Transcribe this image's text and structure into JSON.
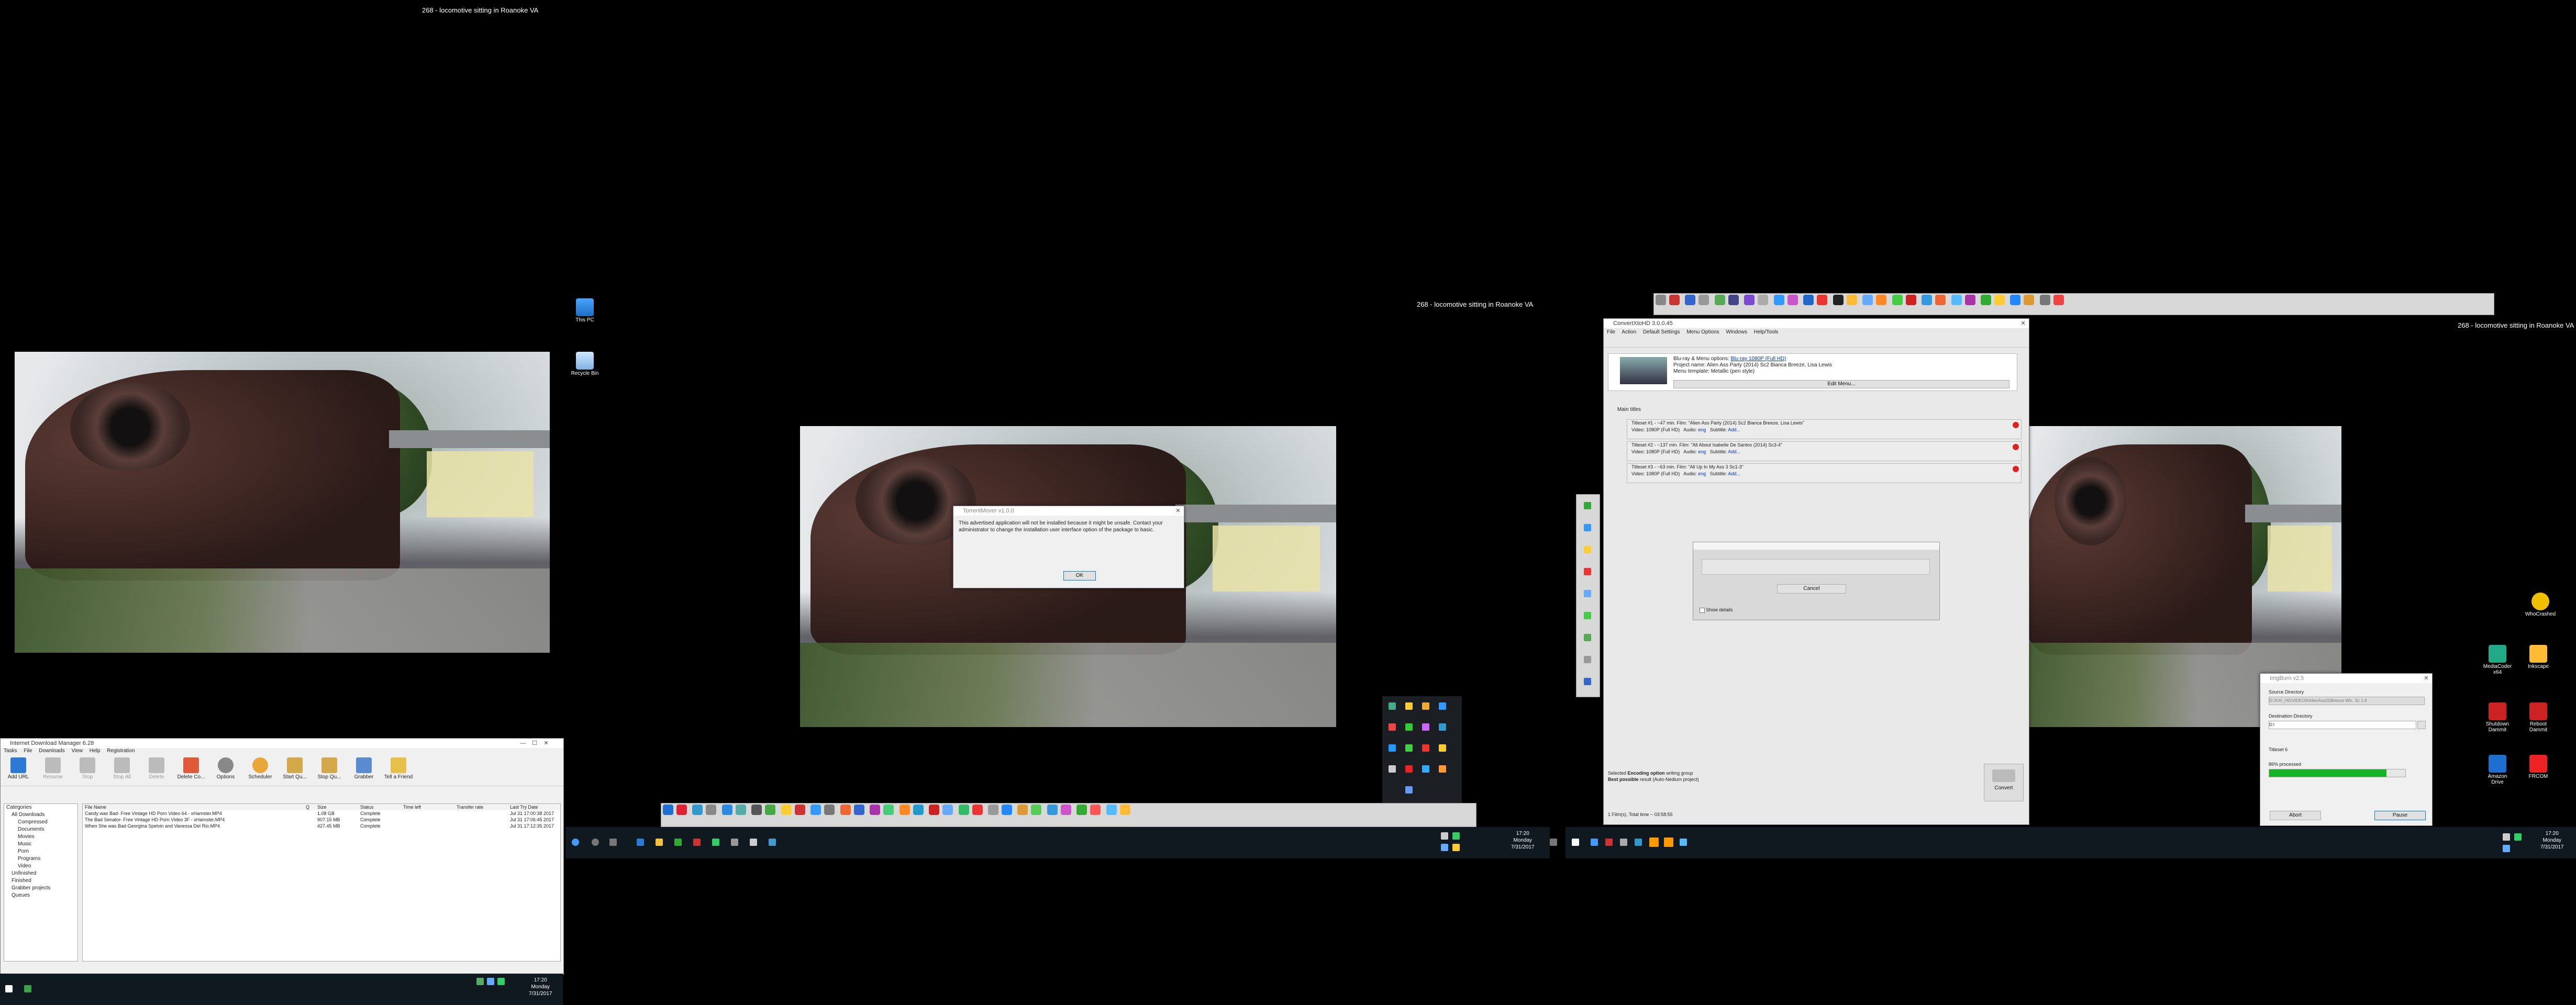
{
  "wallpaper_caption": "268 - locomotive sitting in Roanoke VA",
  "desktop_icons": {
    "this_pc": "This PC",
    "recycle_bin": "Recycle Bin",
    "right": [
      "WhoCrashed",
      "MediaCoder x64",
      "Inkscape",
      "Shutdown Dammit",
      "Reboot Dammit",
      "Amazon Drive",
      "FRCOM"
    ]
  },
  "idm": {
    "title": "Internet Download Manager 6.28",
    "menu": [
      "Tasks",
      "File",
      "Downloads",
      "View",
      "Help",
      "Registration"
    ],
    "toolbar": [
      "Add URL",
      "Resume",
      "Stop",
      "Stop All",
      "Delete",
      "Delete Co...",
      "Options",
      "Scheduler",
      "Start Qu...",
      "Stop Qu...",
      "Grabber",
      "Tell a Friend"
    ],
    "tree": [
      "Categories",
      "All Downloads",
      "Compressed",
      "Documents",
      "Movies",
      "Music",
      "Porn",
      "Programs",
      "Video",
      "Unfinished",
      "Finished",
      "Grabber projects",
      "Queues"
    ],
    "columns": [
      "File Name",
      "Q",
      "Size",
      "Status",
      "Time left",
      "Transfer rate",
      "Last Try Date"
    ],
    "rows": [
      [
        "Candy was Bad- Free Vintage HD Porn Video 64 - xHamster.MP4",
        "",
        "1.08 GB",
        "Complete",
        "",
        "",
        "Jul 31 17:00:38 2017"
      ],
      [
        "The Bad Senator- Free Vintage HD Porn Video 3F - xHamster.MP4",
        "",
        "907.15 MB",
        "Complete",
        "",
        "",
        "Jul 31 17:06:45 2017"
      ],
      [
        "When She was Bad Georgina Spelvin and Vanessa Del Rio.MP4",
        "",
        "427.45 MB",
        "Complete",
        "",
        "",
        "Jul 31 17:12:35 2017"
      ]
    ]
  },
  "tray_left": {
    "time": "17:20",
    "day": "Monday",
    "date": "7/31/2017"
  },
  "tray_mid": {
    "time": "17:20",
    "day": "Monday",
    "date": "7/31/2017"
  },
  "tray_right": {
    "time": "17:20",
    "day": "Monday",
    "date": "7/31/2017"
  },
  "msgbox": {
    "title": "TorrentMover v1.0.0",
    "text": "This advertised application will not be installed because it might be unsafe. Contact your administrator to change the installation user interface option of the package to basic.",
    "ok": "OK"
  },
  "convertx": {
    "title": "ConvertXtoHD 3.0.0.45",
    "menu": [
      "File",
      "Action",
      "Default Settings",
      "Menu Options",
      "Windows",
      "Help/Tools"
    ],
    "info_line1": "Blu-ray & Menu options:",
    "info_link1": "Blu-ray 1080P (Full HD)",
    "info_line2": "Project name: Alien Ass Party (2014) Sc2 Bianca Breeze, Lisa Lewis",
    "info_line3": "Menu template: Metallic (pen style)",
    "edit_menu": "Edit Menu...",
    "main_titles": "Main titles",
    "titles": [
      {
        "name": "Titleset #1 - ~47 min. Film: \"Alien Ass Party (2014) Sc2 Bianca Breeze, Lisa Lewis\"",
        "video": "1080P (Full HD)",
        "audio": "eng",
        "subtitle": "Add..."
      },
      {
        "name": "Titleset #2 - ~137 min. Film: \"All About Isabelle De Santos (2014) Sc3-4\"",
        "video": "1080P (Full HD)",
        "audio": "eng",
        "subtitle": "Add..."
      },
      {
        "name": "Titleset #3 - ~63 min. Film: \"All Up In My Ass 3 Sc1-3\"",
        "video": "1080P (Full HD)",
        "audio": "eng",
        "subtitle": "Add..."
      }
    ],
    "video_label": "Video:",
    "audio_label": "Audio:",
    "subtitle_label": "Subtitle:",
    "progress_cancel": "Cancel",
    "show_details": "Show details",
    "status_line1a": "Selected",
    "status_line1b": "Encoding option",
    "status_line1c": "writing group",
    "status_line2a": "Best possible",
    "status_line2b": "result (Auto-Nedium project)",
    "convert": "Convert",
    "footer": "1 Film(s), Total time ~ 03:58:55"
  },
  "burn": {
    "title": "ImgBurn v2.5",
    "source_label": "Source Directory",
    "source_value": "D:\\X\\A\\_HD\\VIDEOS\\AlienAss(S)Breeze Wtc. Sc 1.8",
    "dest_label": "Destination Directory",
    "dest_value": "D:\\",
    "titleset": "Titleset 6",
    "processed": "86% processed",
    "progress": 0.86,
    "abort": "Abort",
    "pause": "Pause"
  },
  "colors": {
    "progress_green": "#18b428",
    "taskbar": "#101820",
    "link_blue": "#0033cc"
  }
}
